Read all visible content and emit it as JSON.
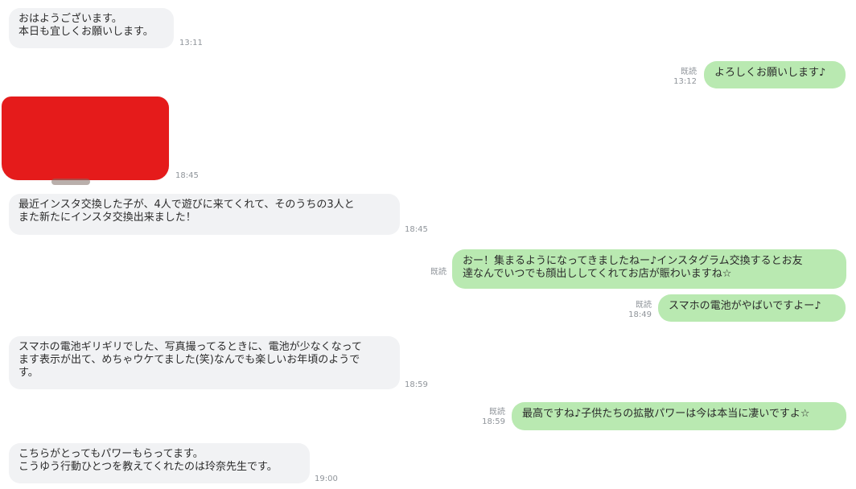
{
  "messages": [
    {
      "side": "in",
      "text": "おはようございます。\n本日も宜しくお願いします。",
      "time": "13:11"
    },
    {
      "side": "out",
      "read": "既読",
      "text": "よろしくお願いします♪",
      "time": "13:12"
    },
    {
      "side": "in",
      "image": "redacted-photo",
      "time": "18:45"
    },
    {
      "side": "in",
      "text": "最近インスタ交換した子が、4人で遊びに来てくれて、そのうちの3人と\nまた新たにインスタ交換出来ました！",
      "time": "18:45"
    },
    {
      "side": "out",
      "read": "既読",
      "text": "おー！集まるようになってきましたねー♪インスタグラム交換するとお友\n達なんでいつでも顔出ししてくれてお店が賑わいますね☆"
    },
    {
      "side": "out",
      "read": "既読",
      "text": "スマホの電池がやばいですよー♪",
      "time": "18:49"
    },
    {
      "side": "in",
      "text": "スマホの電池ギリギリでした、写真撮ってるときに、電池が少なくなって\nます表示が出て、めちゃウケてました(笑)なんでも楽しいお年頃のようで\nす。",
      "time": "18:59"
    },
    {
      "side": "out",
      "read": "既読",
      "text": "最高ですね♪子供たちの拡散パワーは今は本当に凄いですよ☆",
      "time": "18:59"
    },
    {
      "side": "in",
      "text": "こちらがとってもパワーもらってます。\nこうゆう行動ひとつを教えてくれたのは玲奈先生です。",
      "time": "19:00"
    }
  ],
  "colors": {
    "incoming_bubble": "#f1f2f4",
    "outgoing_bubble": "#b9e9b1",
    "meta_text": "#8f949a",
    "redaction": "#e51b1b"
  }
}
